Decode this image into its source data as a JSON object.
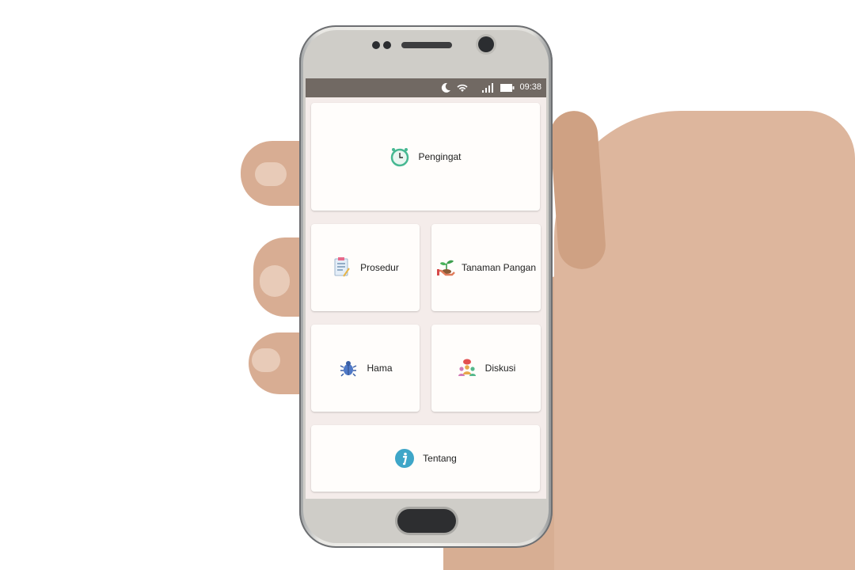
{
  "status_bar": {
    "time": "09:38",
    "icons": [
      "moon-icon",
      "wifi-icon",
      "signal-icon",
      "battery-icon"
    ]
  },
  "menu": {
    "pengingat": {
      "label": "Pengingat",
      "icon": "alarm-clock-icon"
    },
    "prosedur": {
      "label": "Prosedur",
      "icon": "checklist-icon"
    },
    "tanaman_pangan": {
      "label": "Tanaman Pangan",
      "icon": "seedling-hand-icon"
    },
    "hama": {
      "label": "Hama",
      "icon": "bug-icon"
    },
    "diskusi": {
      "label": "Diskusi",
      "icon": "discussion-icon"
    },
    "tentang": {
      "label": "Tentang",
      "icon": "info-icon"
    }
  },
  "colors": {
    "status_bar": "#716963",
    "card_background": "#fffdfb",
    "screen_background": "#f4ecea",
    "info_icon": "#3ea6c8"
  }
}
